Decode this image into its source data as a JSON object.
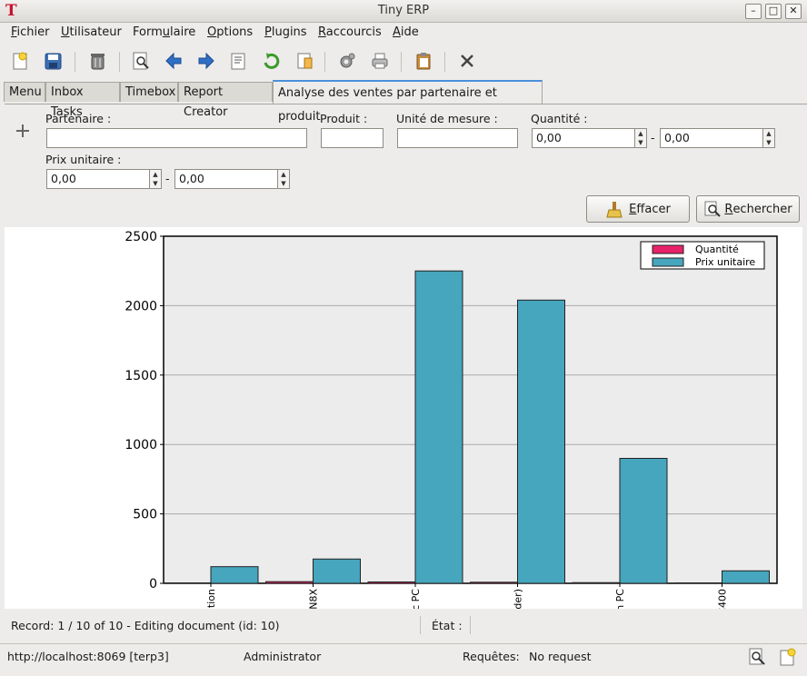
{
  "window": {
    "title": "Tiny ERP",
    "app_icon": "T"
  },
  "menu": [
    {
      "label": "Fichier",
      "ul": "F",
      "rest": "ichier"
    },
    {
      "label": "Utilisateur",
      "ul": "U",
      "rest": "tilisateur"
    },
    {
      "label": "Formulaire",
      "pre": "Form",
      "ul": "u",
      "rest": "laire"
    },
    {
      "label": "Options",
      "ul": "O",
      "rest": "ptions"
    },
    {
      "label": "Plugins",
      "ul": "P",
      "rest": "lugins"
    },
    {
      "label": "Raccourcis",
      "ul": "R",
      "rest": "accourcis"
    },
    {
      "label": "Aide",
      "ul": "A",
      "rest": "ide"
    }
  ],
  "tabs": [
    "Menu",
    "Inbox Tasks",
    "Timebox",
    "Report Creator",
    "Analyse des ventes par partenaire et produit"
  ],
  "form": {
    "partenaire_label": "Partenaire :",
    "produit_label": "Produit :",
    "unite_label": "Unité de mesure :",
    "quantite_label": "Quantité :",
    "quantite_min": "0,00",
    "quantite_max": "0,00",
    "prix_label": "Prix unitaire :",
    "prix_min": "0,00",
    "prix_max": "0,00",
    "range_sep": "-",
    "effacer_label": "ffacer",
    "effacer_ul": "E",
    "rechercher_label": "echercher",
    "rechercher_ul": "R"
  },
  "chart_data": {
    "type": "bar",
    "categories": [
      "ntion",
      "N8X",
      "ic PC",
      "rder)",
      "n PC",
      "C400"
    ],
    "series": [
      {
        "name": "Quantité",
        "color": "#e8226a",
        "values": [
          3,
          12,
          10,
          8,
          5,
          3
        ]
      },
      {
        "name": "Prix unitaire",
        "color": "#46a6bd",
        "values": [
          120,
          175,
          2250,
          2040,
          900,
          90
        ]
      }
    ],
    "ylim": [
      0,
      2500
    ],
    "yticks": [
      "0",
      "500",
      "1000",
      "1500",
      "2000",
      "2500"
    ],
    "grid": true,
    "legend": "top-right"
  },
  "status": {
    "record": "Record: 1 / 10 of 10 - Editing document (id: 10)",
    "etat_label": "État :",
    "url": "http://localhost:8069 [terp3]",
    "user": "Administrator",
    "requetes_label": "Requêtes:",
    "requetes_value": "No request"
  },
  "colors": {
    "accent_tab_border": "#4a90d9",
    "bar_series1": "#e8226a",
    "bar_series2": "#46a6bd"
  }
}
